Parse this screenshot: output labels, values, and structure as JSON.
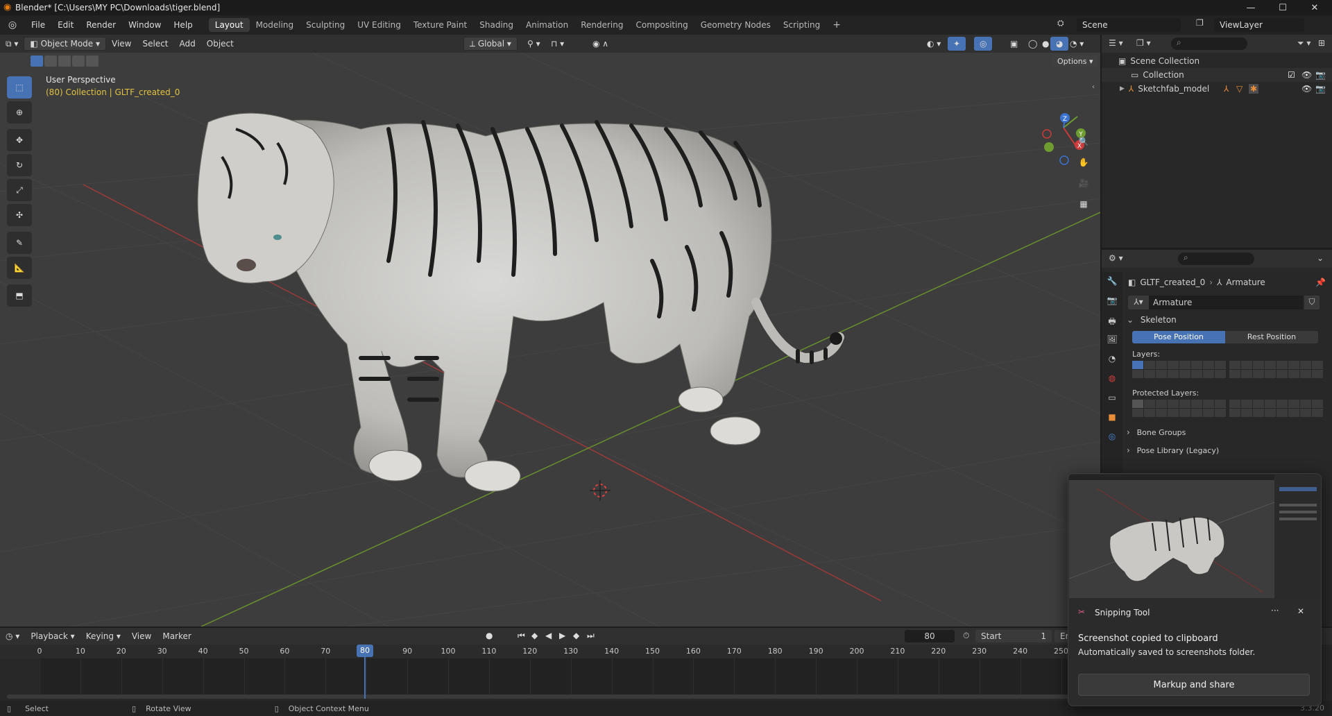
{
  "window": {
    "title": "Blender* [C:\\Users\\MY PC\\Downloads\\tiger.blend]",
    "controls": {
      "minimize": "—",
      "maximize": "☐",
      "close": "✕"
    }
  },
  "menubar": {
    "menus": [
      "File",
      "Edit",
      "Render",
      "Window",
      "Help"
    ],
    "workspaces": [
      "Layout",
      "Modeling",
      "Sculpting",
      "UV Editing",
      "Texture Paint",
      "Shading",
      "Animation",
      "Rendering",
      "Compositing",
      "Geometry Nodes",
      "Scripting"
    ],
    "active_workspace": "Layout",
    "add_tab": "+",
    "scene_label": "Scene",
    "viewlayer_label": "ViewLayer"
  },
  "viewport": {
    "mode": "Object Mode",
    "menus": [
      "View",
      "Select",
      "Add",
      "Object"
    ],
    "transform_orientation": "Global",
    "options_label": "Options",
    "overlay_title": "User Perspective",
    "overlay_subtitle": "(80) Collection | GLTF_created_0",
    "axis_labels": {
      "x": "X",
      "y": "Y",
      "z": "Z"
    }
  },
  "outliner": {
    "rows": [
      {
        "label": "Scene Collection",
        "indent": 0
      },
      {
        "label": "Collection",
        "indent": 1
      },
      {
        "label": "Sketchfab_model",
        "indent": 1
      }
    ]
  },
  "properties": {
    "breadcrumb_object": "GLTF_created_0",
    "breadcrumb_data": "Armature",
    "datablock_name": "Armature",
    "panels": {
      "skeleton": "Skeleton",
      "pose_position": "Pose Position",
      "rest_position": "Rest Position",
      "layers": "Layers:",
      "protected_layers": "Protected Layers:",
      "bone_groups": "Bone Groups",
      "pose_library": "Pose Library (Legacy)"
    }
  },
  "timeline": {
    "menus": [
      "Playback",
      "Keying",
      "View",
      "Marker"
    ],
    "current_frame": "80",
    "start_label": "Start",
    "start_value": "1",
    "end_label": "End",
    "ticks": [
      "0",
      "10",
      "20",
      "30",
      "40",
      "50",
      "60",
      "70",
      "80",
      "90",
      "100",
      "110",
      "120",
      "130",
      "140",
      "150",
      "160",
      "170",
      "180",
      "190",
      "200",
      "210",
      "220",
      "230",
      "240",
      "250"
    ]
  },
  "statusbar": {
    "select": "Select",
    "rotate_view": "Rotate View",
    "context_menu": "Object Context Menu",
    "version": "3.3.20"
  },
  "toast": {
    "app_name": "Snipping Tool",
    "more": "···",
    "close": "✕",
    "line1": "Screenshot copied to clipboard",
    "line2": "Automatically saved to screenshots folder.",
    "button": "Markup and share"
  },
  "colors": {
    "accent": "#4772b3",
    "active_text": "#e0c341",
    "x_axis": "#cc3b3b",
    "y_axis": "#6e9c31",
    "z_axis": "#3b73d0"
  }
}
